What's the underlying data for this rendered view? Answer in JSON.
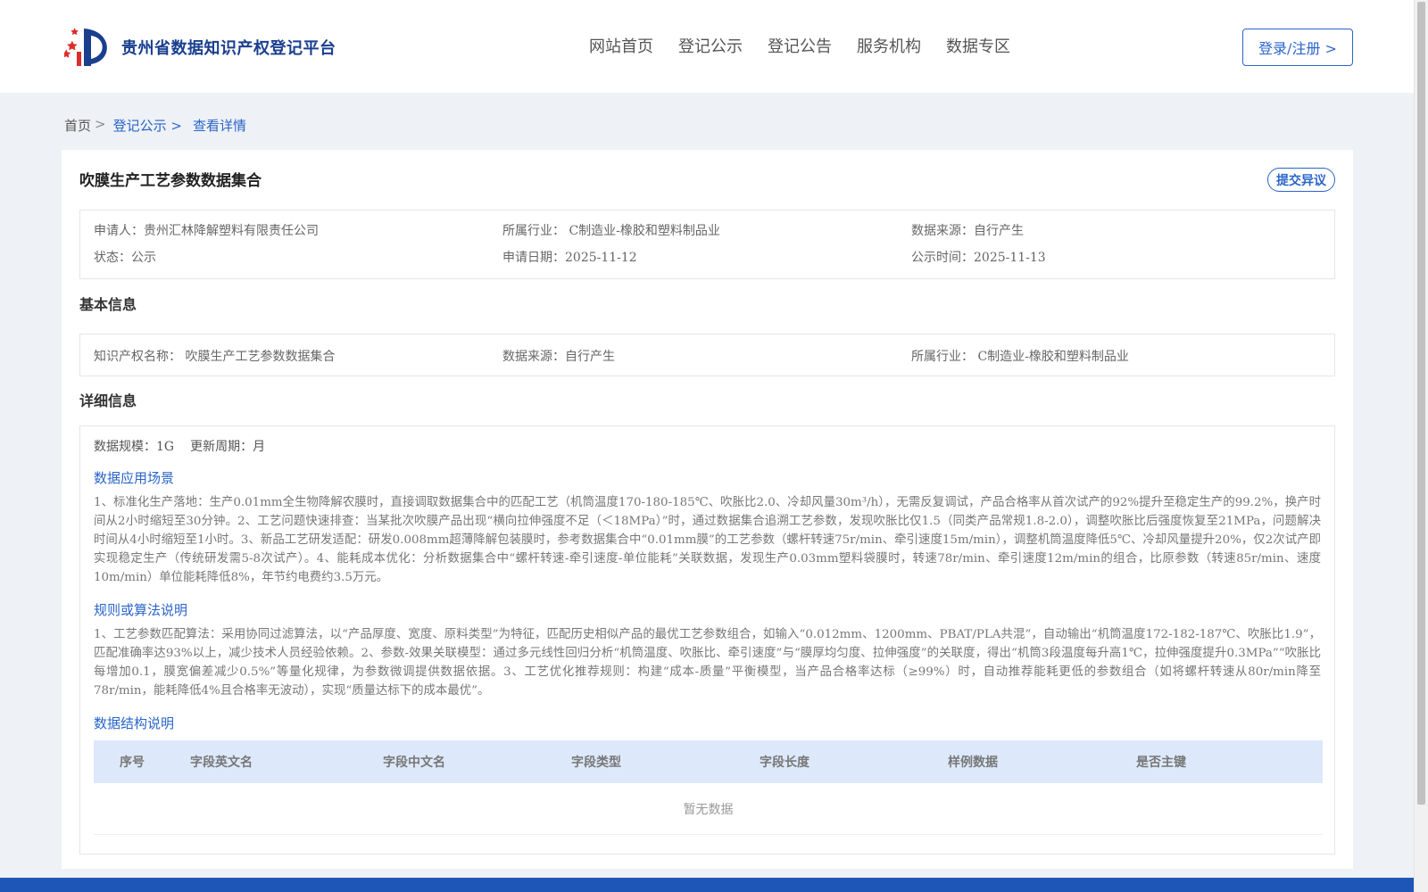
{
  "header": {
    "logo_text": "贵州省数据知识产权登记平台",
    "nav": [
      "网站首页",
      "登记公示",
      "登记公告",
      "服务机构",
      "数据专区"
    ],
    "login_label": "登录/注册 >"
  },
  "breadcrumb": {
    "home": "首页",
    "sep": ">",
    "items": [
      "登记公示 >",
      "查看详情"
    ]
  },
  "detail": {
    "title": "吹膜生产工艺参数数据集合",
    "objection_label": "提交异议",
    "meta": [
      [
        "申请人：贵州汇林降解塑料有限责任公司",
        "所属行业： C制造业-橡胶和塑料制品业",
        "数据来源：自行产生"
      ],
      [
        "状态：公示",
        "申请日期：2025-11-12",
        "公示时间：2025-11-13"
      ]
    ],
    "basic_heading": "基本信息",
    "basic": [
      "知识产权名称： 吹膜生产工艺参数数据集合",
      "数据来源：自行产生",
      "所属行业： C制造业-橡胶和塑料制品业"
    ],
    "detail_heading": "详细信息",
    "scale": "数据规模：1G",
    "update_cycle": "更新周期：月",
    "scenario_heading": "数据应用场景",
    "scenario_text": "1、标准化生产落地：生产0.01mm全生物降解农膜时，直接调取数据集合中的匹配工艺（机筒温度170-180-185℃、吹胀比2.0、冷却风量30m³/h），无需反复调试，产品合格率从首次试产的92%提升至稳定生产的99.2%，换产时间从2小时缩短至30分钟。2、工艺问题快速排查：当某批次吹膜产品出现“横向拉伸强度不足（＜18MPa）”时，通过数据集合追溯工艺参数，发现吹胀比仅1.5（同类产品常规1.8-2.0），调整吹胀比后强度恢复至21MPa，问题解决时间从4小时缩短至1小时。3、新品工艺研发适配：研发0.008mm超薄降解包装膜时，参考数据集合中“0.01mm膜”的工艺参数（螺杆转速75r/min、牵引速度15m/min），调整机筒温度降低5℃、冷却风量提升20%，仅2次试产即实现稳定生产（传统研发需5-8次试产）。4、能耗成本优化：分析数据集合中“螺杆转速-牵引速度-单位能耗”关联数据，发现生产0.03mm塑料袋膜时，转速78r/min、牵引速度12m/min的组合，比原参数（转速85r/min、速度10m/min）单位能耗降低8%，年节约电费约3.5万元。",
    "rules_heading": "规则或算法说明",
    "rules_text": "1、工艺参数匹配算法：采用协同过滤算法，以“产品厚度、宽度、原料类型”为特征，匹配历史相似产品的最优工艺参数组合，如输入“0.012mm、1200mm、PBAT/PLA共混”，自动输出“机筒温度172-182-187℃、吹胀比1.9”，匹配准确率达93%以上，减少技术人员经验依赖。2、参数-效果关联模型：通过多元线性回归分析“机筒温度、吹胀比、牵引速度”与“膜厚均匀度、拉伸强度”的关联度，得出“机筒3段温度每升高1℃，拉伸强度提升0.3MPa”“吹胀比每增加0.1，膜宽偏差减少0.5%”等量化规律，为参数微调提供数据依据。3、工艺优化推荐规则：构建“成本-质量”平衡模型，当产品合格率达标（≥99%）时，自动推荐能耗更低的参数组合（如将螺杆转速从80r/min降至78r/min，能耗降低4%且合格率无波动），实现“质量达标下的成本最优”。",
    "structure_heading": "数据结构说明",
    "table": {
      "columns": [
        "序号",
        "字段英文名",
        "字段中文名",
        "字段类型",
        "字段长度",
        "样例数据",
        "是否主键"
      ],
      "empty_text": "暂无数据"
    }
  }
}
